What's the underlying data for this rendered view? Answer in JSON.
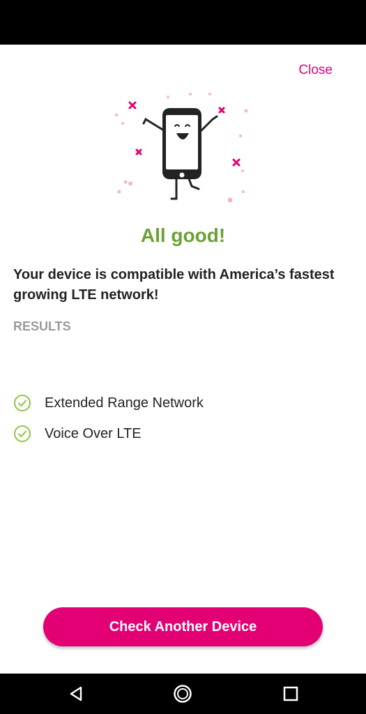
{
  "header": {
    "close_label": "Close"
  },
  "result": {
    "headline": "All good!",
    "message": "Your device is compatible with America’s fastest growing LTE network!",
    "results_heading": "RESULTS",
    "items": [
      {
        "label": "Extended Range Network",
        "status_icon": "check-circle-icon"
      },
      {
        "label": "Voice Over LTE",
        "status_icon": "check-circle-icon"
      }
    ]
  },
  "action": {
    "button_label": "Check Another Device"
  },
  "colors": {
    "brand": "#e20074",
    "success": "#6aa232",
    "check": "#8cc63f"
  },
  "nav": {
    "icons": [
      "back-icon",
      "home-icon",
      "recents-icon"
    ]
  }
}
